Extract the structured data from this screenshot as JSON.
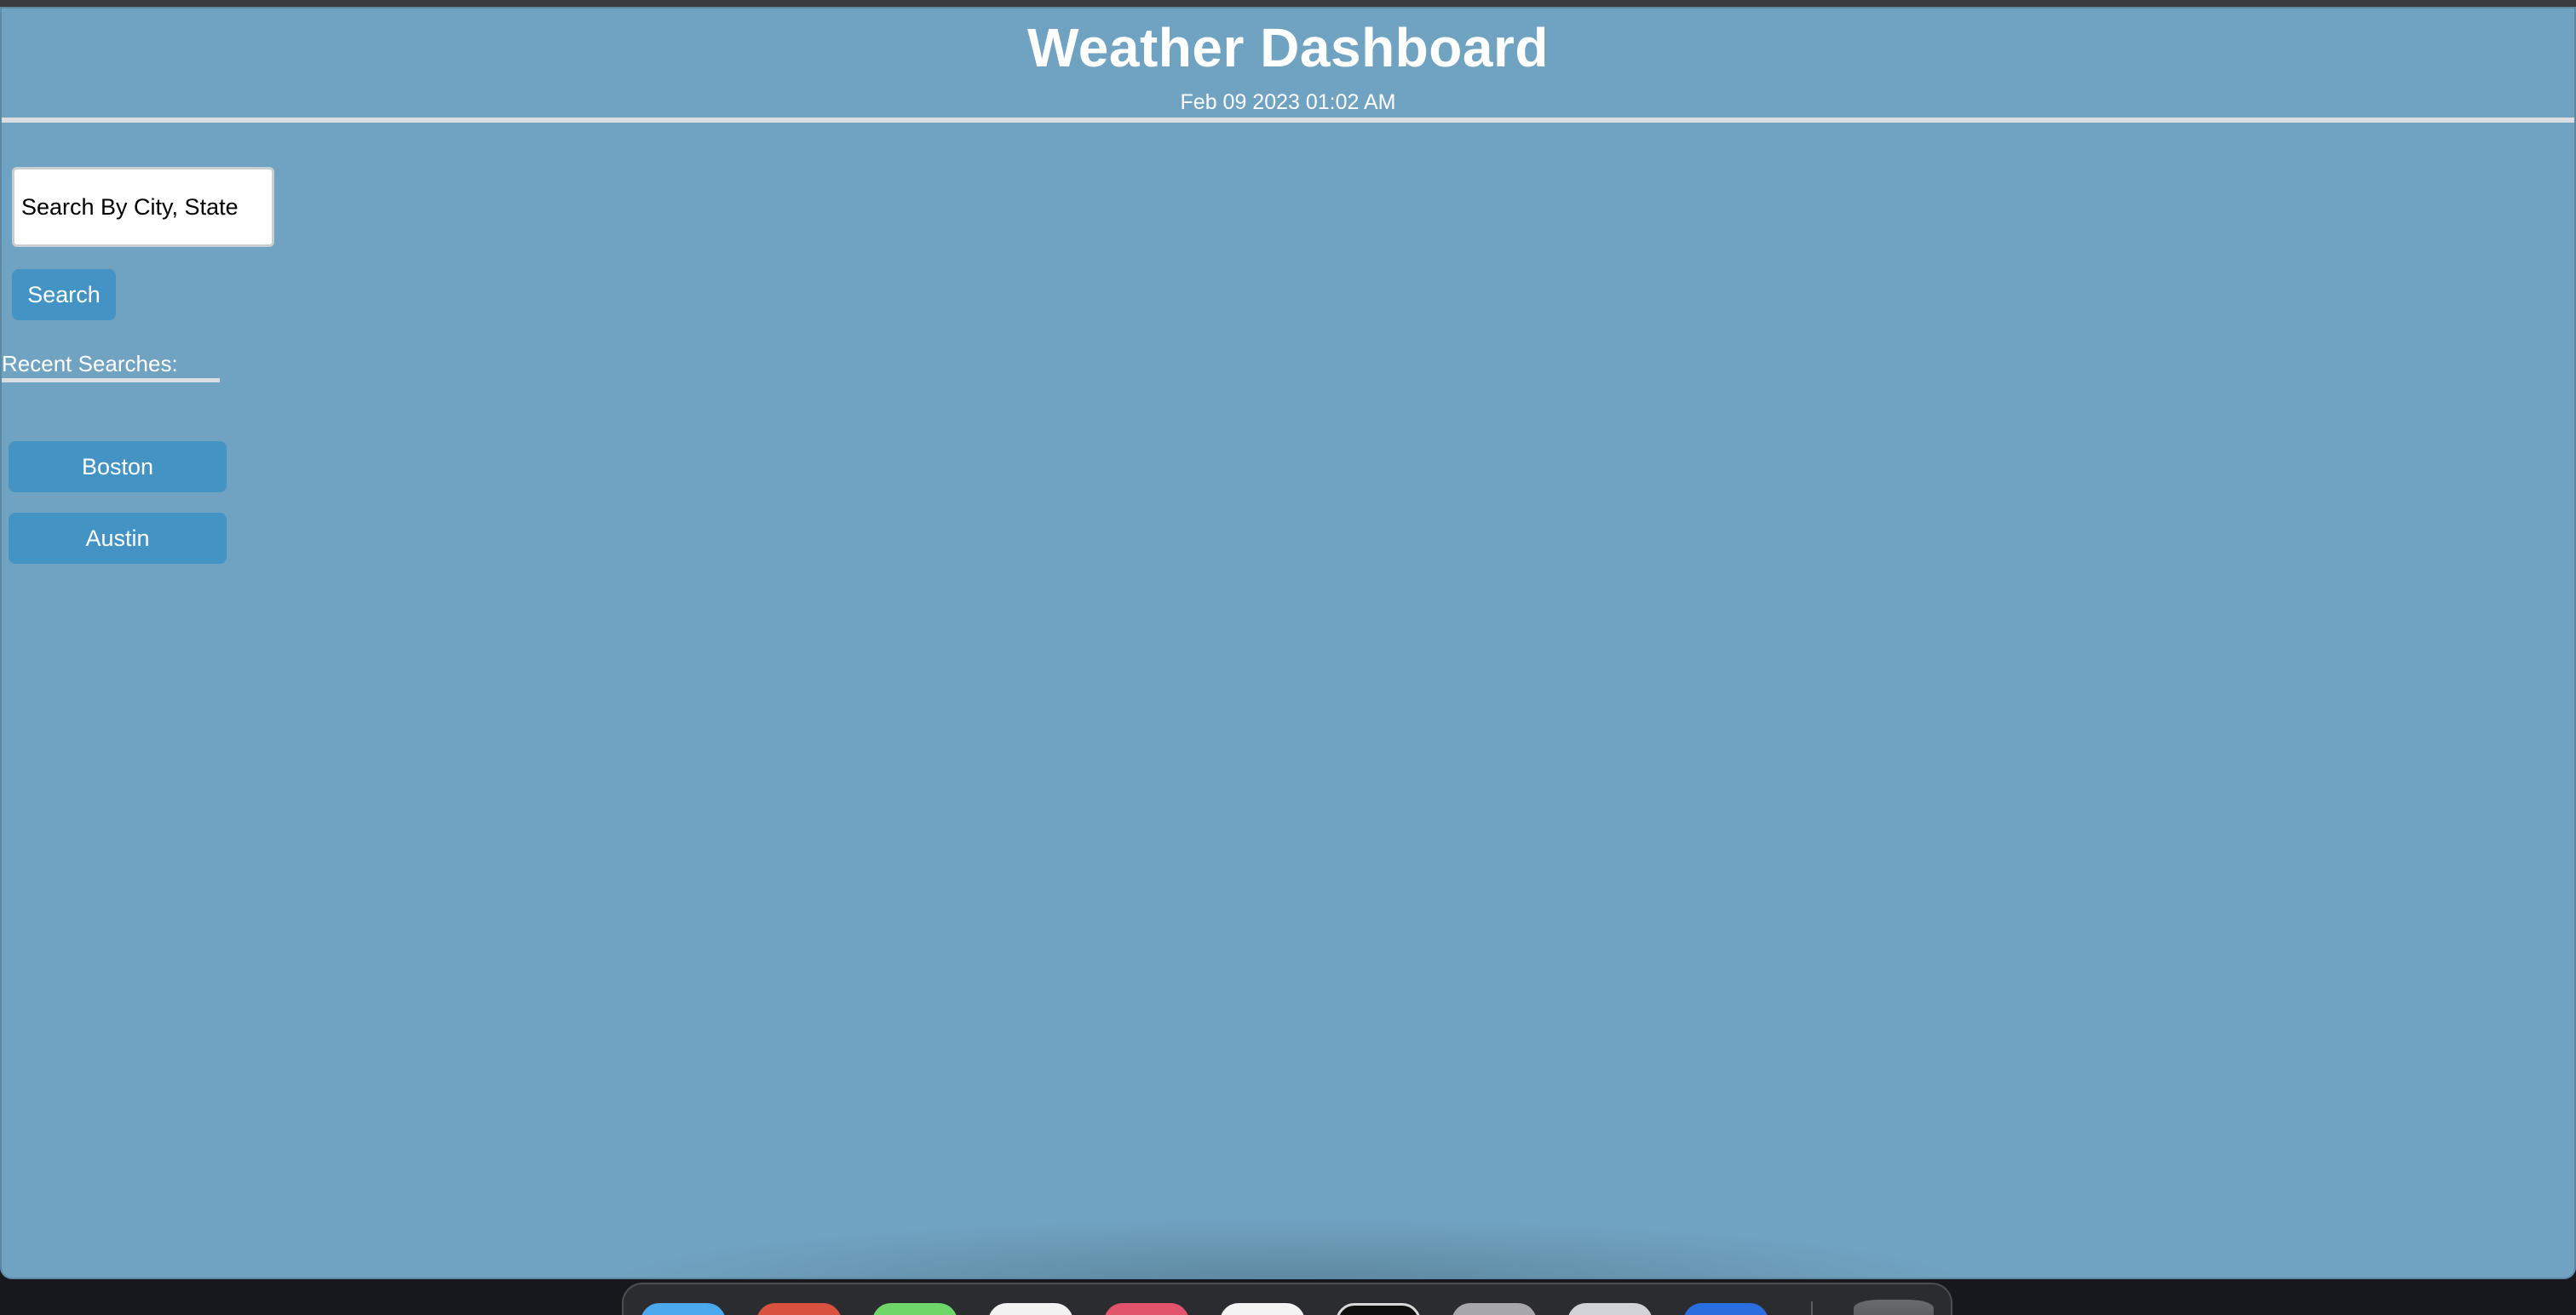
{
  "header": {
    "title": "Weather Dashboard",
    "datetime": "Feb 09 2023 01:02 AM"
  },
  "search": {
    "placeholder": "Search By City, State",
    "value": "",
    "button_label": "Search"
  },
  "recent": {
    "label": "Recent Searches:",
    "cities": [
      "Boston",
      "Austin"
    ]
  },
  "dock": {
    "apps": [
      {
        "name": "finder-icon",
        "color": "#4ba8ec"
      },
      {
        "name": "chrome-icon",
        "color": "#d9523f"
      },
      {
        "name": "messages-icon",
        "color": "#6fd66a"
      },
      {
        "name": "calendar-icon",
        "color": "#f2f2f2"
      },
      {
        "name": "music-icon",
        "color": "#e2546b"
      },
      {
        "name": "notes-icon",
        "color": "#f4f4f4"
      },
      {
        "name": "terminal-icon",
        "color": "#0f0f0f"
      },
      {
        "name": "settings-icon",
        "color": "#a7a7a9"
      },
      {
        "name": "safari-icon",
        "color": "#cfd3d8"
      },
      {
        "name": "vscode-icon",
        "color": "#2a6fe0"
      }
    ],
    "trash": "trash-icon"
  },
  "colors": {
    "background": "#70a3c1",
    "button": "#4394c5",
    "text": "#ffffff",
    "rule": "#d9dde0"
  }
}
